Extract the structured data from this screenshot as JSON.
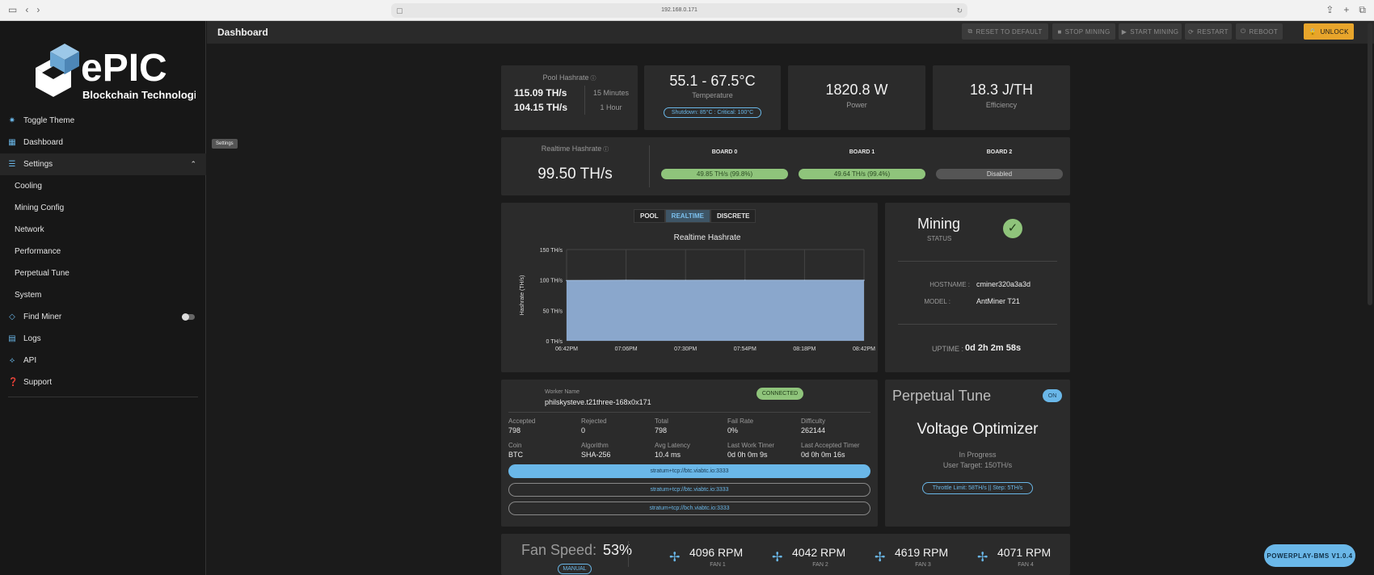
{
  "browser": {
    "url": "192.168.0.171"
  },
  "brand": {
    "name": "ePIC",
    "tagline": "Blockchain Technologies"
  },
  "sidebar": {
    "items": [
      {
        "label": "Toggle Theme",
        "icon": "sun-icon"
      },
      {
        "label": "Dashboard",
        "icon": "dashboard-icon"
      },
      {
        "label": "Settings",
        "icon": "sliders-icon"
      },
      {
        "label": "Cooling"
      },
      {
        "label": "Mining Config"
      },
      {
        "label": "Network"
      },
      {
        "label": "Performance"
      },
      {
        "label": "Perpetual Tune"
      },
      {
        "label": "System"
      },
      {
        "label": "Find Miner",
        "icon": "diamond-icon"
      },
      {
        "label": "Logs",
        "icon": "log-icon"
      },
      {
        "label": "API",
        "icon": "api-icon"
      },
      {
        "label": "Support",
        "icon": "help-icon"
      }
    ],
    "tooltip": "Settings"
  },
  "header": {
    "title": "Dashboard",
    "buttons": {
      "reset": "RESET TO DEFAULT",
      "stop": "STOP MINING",
      "start": "START MINING",
      "restart": "RESTART",
      "reboot": "REBOOT",
      "unlock": "UNLOCK"
    }
  },
  "stats": {
    "pool_hashrate_label": "Pool Hashrate",
    "pool_15m": "115.09 TH/s",
    "pool_1h": "104.15 TH/s",
    "label_15m": "15 Minutes",
    "label_1h": "1 Hour",
    "temperature": "55.1 - 67.5°C",
    "temperature_label": "Temperature",
    "temp_limits": "Shutdown: 85°C : Critical: 100°C",
    "power": "1820.8 W",
    "power_label": "Power",
    "efficiency": "18.3 J/TH",
    "efficiency_label": "Efficiency"
  },
  "realtime": {
    "label": "Realtime Hashrate",
    "value": "99.50 TH/s",
    "boards": [
      {
        "name": "BOARD 0",
        "value": "49.85 TH/s (99.8%)"
      },
      {
        "name": "BOARD 1",
        "value": "49.64 TH/s (99.4%)"
      },
      {
        "name": "BOARD 2",
        "value": "Disabled"
      }
    ]
  },
  "chart_tabs": {
    "pool": "POOL",
    "realtime": "REALTIME",
    "discrete": "DISCRETE"
  },
  "chart_data": {
    "type": "area",
    "title": "Realtime Hashrate",
    "ylabel": "Hashrate (TH/s)",
    "xlabel": "",
    "x": [
      "06:42PM",
      "07:06PM",
      "07:30PM",
      "07:54PM",
      "08:18PM",
      "08:42PM"
    ],
    "yticks": [
      "0 TH/s",
      "50 TH/s",
      "100 TH/s",
      "150 TH/s"
    ],
    "ylim": [
      0,
      150
    ],
    "series": [
      {
        "values": [
          99,
          99.5,
          99.4,
          99.6,
          99.5,
          99.5
        ]
      }
    ],
    "color": "#8aa7cc",
    "grid": true
  },
  "status": {
    "state": "Mining",
    "state_label": "STATUS",
    "hostname_label": "HOSTNAME :",
    "hostname": "cminer320a3a3d",
    "model_label": "MODEL :",
    "model": "AntMiner T21",
    "uptime_label": "UPTIME :",
    "uptime": "0d 2h 2m 58s"
  },
  "worker": {
    "name_label": "Worker Name",
    "name": "philskysteve.t21three-168x0x171",
    "connection": "CONNECTED",
    "fields": [
      {
        "k": "Accepted",
        "v": "798"
      },
      {
        "k": "Rejected",
        "v": "0"
      },
      {
        "k": "Total",
        "v": "798"
      },
      {
        "k": "Fail Rate",
        "v": "0%"
      },
      {
        "k": "Difficulty",
        "v": "262144"
      },
      {
        "k": "Coin",
        "v": "BTC"
      },
      {
        "k": "Algorithm",
        "v": "SHA-256"
      },
      {
        "k": "Avg Latency",
        "v": "10.4 ms"
      },
      {
        "k": "Last Work Timer",
        "v": "0d 0h 0m 9s"
      },
      {
        "k": "Last Accepted Timer",
        "v": "0d 0h 0m 16s"
      }
    ],
    "pools": [
      "stratum+tcp://btc.viabtc.io:3333",
      "stratum+tcp://btc.viabtc.io:3333",
      "stratum+tcp://bch.viabtc.io:3333"
    ]
  },
  "perpetual": {
    "title": "Perpetual Tune",
    "state": "ON",
    "mode": "Voltage Optimizer",
    "progress": "In Progress",
    "target": "User Target: 150TH/s",
    "limit": "Throttle Limit: 58TH/s || Step: 5TH/s"
  },
  "fans": {
    "label": "Fan Speed:",
    "percent": "53%",
    "mode": "MANUAL",
    "items": [
      {
        "rpm": "4096 RPM",
        "name": "FAN 1"
      },
      {
        "rpm": "4042 RPM",
        "name": "FAN 2"
      },
      {
        "rpm": "4619 RPM",
        "name": "FAN 3"
      },
      {
        "rpm": "4071 RPM",
        "name": "FAN 4"
      }
    ]
  },
  "version": "POWERPLAY-BMS V1.0.4"
}
